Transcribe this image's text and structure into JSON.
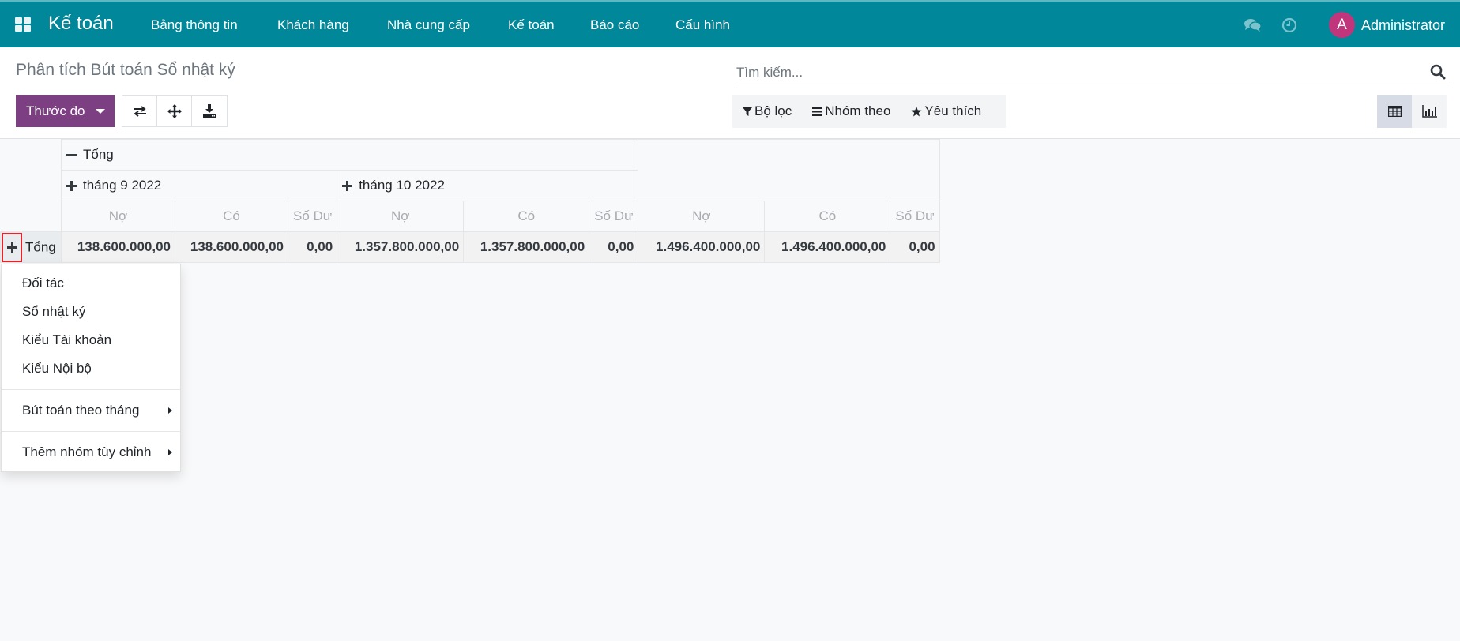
{
  "navbar": {
    "app_name": "Kế toán",
    "menu": [
      {
        "label": "Bảng thông tin"
      },
      {
        "label": "Khách hàng"
      },
      {
        "label": "Nhà cung cấp"
      },
      {
        "label": "Kế toán"
      },
      {
        "label": "Báo cáo"
      },
      {
        "label": "Cấu hình"
      }
    ],
    "icons": [
      "apps-grid-icon",
      "chat-icon",
      "clock-icon"
    ],
    "user": {
      "initial": "A",
      "name": "Administrator",
      "avatar_color": "#c0357c"
    },
    "color": "#00889a"
  },
  "control_panel": {
    "title": "Phân tích Bút toán Sổ nhật ký",
    "measures_label": "Thước đo",
    "measures_color": "#7c3f82",
    "tools": [
      "flip-axis-icon",
      "expand-all-icon",
      "download-icon"
    ],
    "search": {
      "placeholder": "Tìm kiếm...",
      "value": ""
    },
    "filters": [
      {
        "label": "Bộ lọc",
        "icon": "filter-icon"
      },
      {
        "label": "Nhóm theo",
        "icon": "bars-icon"
      },
      {
        "label": "Yêu thích",
        "icon": "star-icon"
      }
    ],
    "views": [
      {
        "name": "pivot",
        "icon": "table-icon",
        "active": true
      },
      {
        "name": "graph",
        "icon": "bar-chart-icon",
        "active": false
      }
    ]
  },
  "pivot": {
    "top_header": {
      "label": "Tổng",
      "expanded": true
    },
    "col_groups": [
      {
        "label": "tháng 9 2022",
        "expanded": false
      },
      {
        "label": "tháng 10 2022",
        "expanded": false
      }
    ],
    "measures": [
      "Nợ",
      "Có",
      "Số Dư"
    ],
    "rows": [
      {
        "label": "Tổng",
        "expanded": false,
        "values": [
          "138.600.000,00",
          "138.600.000,00",
          "0,00",
          "1.357.800.000,00",
          "1.357.800.000,00",
          "0,00",
          "1.496.400.000,00",
          "1.496.400.000,00",
          "0,00"
        ]
      }
    ]
  },
  "groupby_dropdown": {
    "items": [
      {
        "label": "Đối tác"
      },
      {
        "label": "Sổ nhật ký"
      },
      {
        "label": "Kiểu Tài khoản"
      },
      {
        "label": "Kiểu Nội bộ"
      }
    ],
    "submenus": [
      {
        "label": "Bút toán theo tháng"
      },
      {
        "label": "Thêm nhóm tùy chỉnh"
      }
    ]
  }
}
